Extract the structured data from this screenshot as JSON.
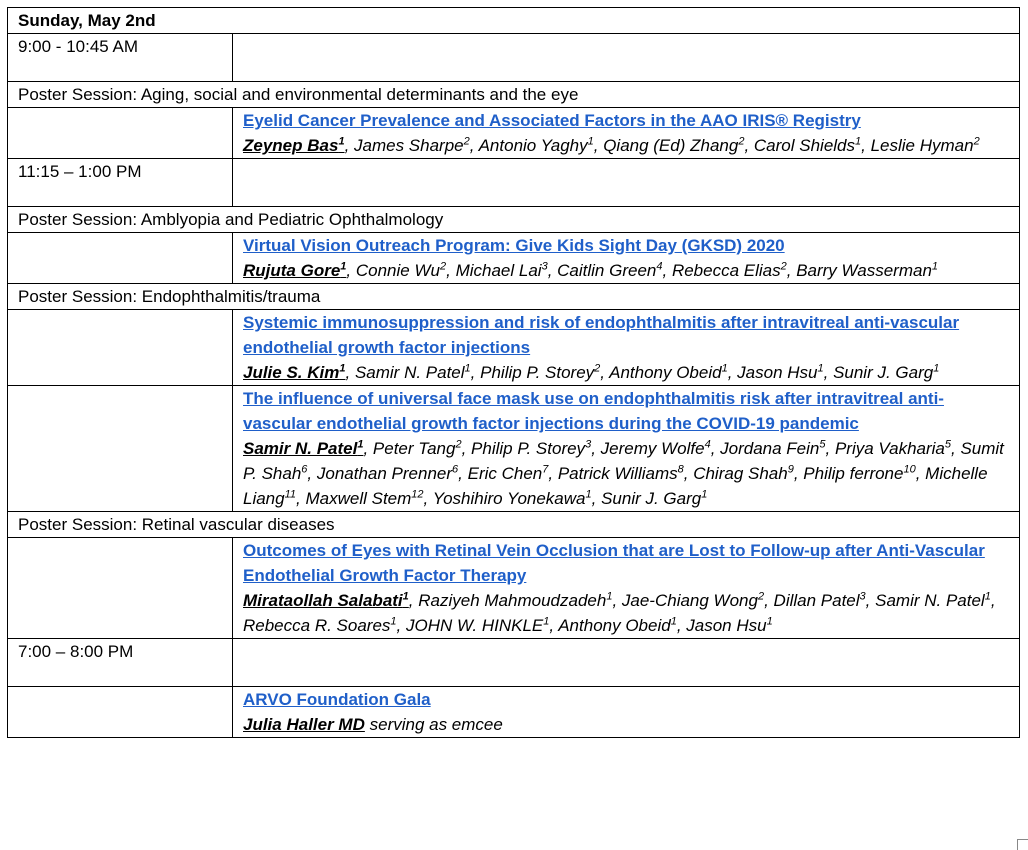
{
  "day": "Sunday, May 2nd",
  "rows": [
    {
      "kind": "time",
      "text": "9:00 - 10:45 AM"
    },
    {
      "kind": "session",
      "text": "Poster Session:  Aging, social and environmental determinants and the eye"
    },
    {
      "kind": "talk",
      "title": "Eyelid Cancer Prevalence and Associated Factors in the AAO IRIS® Registry",
      "authors": [
        {
          "name": "Zeynep Bas",
          "sup": "1",
          "presenter": true
        },
        {
          "name": "James Sharpe",
          "sup": "2"
        },
        {
          "name": "Antonio Yaghy",
          "sup": "1"
        },
        {
          "name": "Qiang (Ed) Zhang",
          "sup": "2"
        },
        {
          "name": "Carol Shields",
          "sup": "1"
        },
        {
          "name": "Leslie Hyman",
          "sup": "2"
        }
      ]
    },
    {
      "kind": "time",
      "text": "11:15 – 1:00 PM"
    },
    {
      "kind": "session",
      "text": "Poster Session:  Amblyopia and Pediatric Ophthalmology"
    },
    {
      "kind": "talk",
      "title": "Virtual Vision Outreach Program: Give Kids Sight Day (GKSD) 2020",
      "authors": [
        {
          "name": "Rujuta Gore",
          "sup": "1",
          "presenter": true
        },
        {
          "name": "Connie Wu",
          "sup": "2"
        },
        {
          "name": "Michael Lai",
          "sup": "3"
        },
        {
          "name": "Caitlin Green",
          "sup": "4"
        },
        {
          "name": "Rebecca Elias",
          "sup": "2"
        },
        {
          "name": "Barry Wasserman",
          "sup": "1"
        }
      ]
    },
    {
      "kind": "session",
      "text": "Poster Session: Endophthalmitis/trauma"
    },
    {
      "kind": "talk",
      "title": "Systemic immunosuppression and risk of endophthalmitis after intravitreal anti-vascular endothelial growth factor injections",
      "authors": [
        {
          "name": "Julie S. Kim",
          "sup": "1",
          "presenter": true
        },
        {
          "name": "Samir N. Patel",
          "sup": "1"
        },
        {
          "name": "Philip P. Storey",
          "sup": "2"
        },
        {
          "name": "Anthony Obeid",
          "sup": "1"
        },
        {
          "name": "Jason Hsu",
          "sup": "1"
        },
        {
          "name": "Sunir J. Garg",
          "sup": "1"
        }
      ]
    },
    {
      "kind": "talk",
      "title": "The influence of universal face mask use on endophthalmitis risk after intravitreal anti-vascular endothelial growth factor injections during the COVID-19 pandemic",
      "authors": [
        {
          "name": "Samir N. Patel",
          "sup": "1",
          "presenter": true
        },
        {
          "name": "Peter Tang",
          "sup": "2"
        },
        {
          "name": "Philip P. Storey",
          "sup": "3"
        },
        {
          "name": "Jeremy Wolfe",
          "sup": "4"
        },
        {
          "name": "Jordana Fein",
          "sup": "5"
        },
        {
          "name": "Priya Vakharia",
          "sup": "5"
        },
        {
          "name": "Sumit P. Shah",
          "sup": "6"
        },
        {
          "name": "Jonathan Prenner",
          "sup": "6"
        },
        {
          "name": "Eric Chen",
          "sup": "7"
        },
        {
          "name": "Patrick Williams",
          "sup": "8"
        },
        {
          "name": "Chirag Shah",
          "sup": "9"
        },
        {
          "name": "Philip ferrone",
          "sup": "10"
        },
        {
          "name": "Michelle Liang",
          "sup": "11"
        },
        {
          "name": "Maxwell Stem",
          "sup": "12"
        },
        {
          "name": "Yoshihiro Yonekawa",
          "sup": "1"
        },
        {
          "name": "Sunir J. Garg",
          "sup": "1"
        }
      ]
    },
    {
      "kind": "session",
      "text": "Poster Session: Retinal vascular diseases"
    },
    {
      "kind": "talk",
      "title": "Outcomes of Eyes with Retinal Vein Occlusion that are Lost to Follow-up after Anti-Vascular Endothelial Growth Factor Therapy",
      "authors": [
        {
          "name": "Mirataollah Salabati",
          "sup": "1",
          "presenter": true
        },
        {
          "name": "Raziyeh Mahmoudzadeh",
          "sup": "1"
        },
        {
          "name": "Jae-Chiang Wong",
          "sup": "2"
        },
        {
          "name": "Dillan Patel",
          "sup": "3"
        },
        {
          "name": "Samir N. Patel",
          "sup": "1"
        },
        {
          "name": "Rebecca R. Soares",
          "sup": "1"
        },
        {
          "name": "JOHN W. HINKLE",
          "sup": "1"
        },
        {
          "name": "Anthony Obeid",
          "sup": "1"
        },
        {
          "name": "Jason Hsu",
          "sup": "1"
        }
      ]
    },
    {
      "kind": "time",
      "text": "7:00 – 8:00 PM"
    },
    {
      "kind": "talk",
      "title": "ARVO Foundation Gala",
      "authors": [
        {
          "name": "Julia Haller MD",
          "presenter": true
        }
      ],
      "suffix": "serving as emcee"
    }
  ],
  "colors": {
    "link": "#1f5fc9",
    "border": "#000000"
  }
}
